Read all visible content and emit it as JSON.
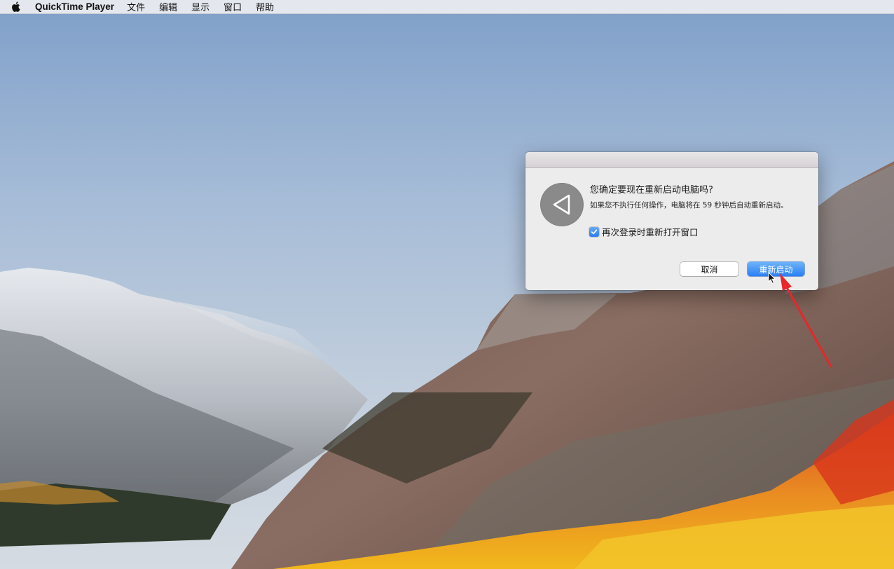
{
  "menubar": {
    "app_name": "QuickTime Player",
    "items": [
      "文件",
      "编辑",
      "显示",
      "窗口",
      "帮助"
    ]
  },
  "dialog": {
    "title": "您确定要现在重新启动电脑吗?",
    "message": "如果您不执行任何操作，电脑将在 59 秒钟后自动重新启动。",
    "checkbox_label": "再次登录时重新打开窗口",
    "checkbox_checked": true,
    "cancel_label": "取消",
    "restart_label": "重新启动"
  },
  "colors": {
    "accent": "#2a7ff3",
    "annotation_arrow": "#e8262a"
  }
}
